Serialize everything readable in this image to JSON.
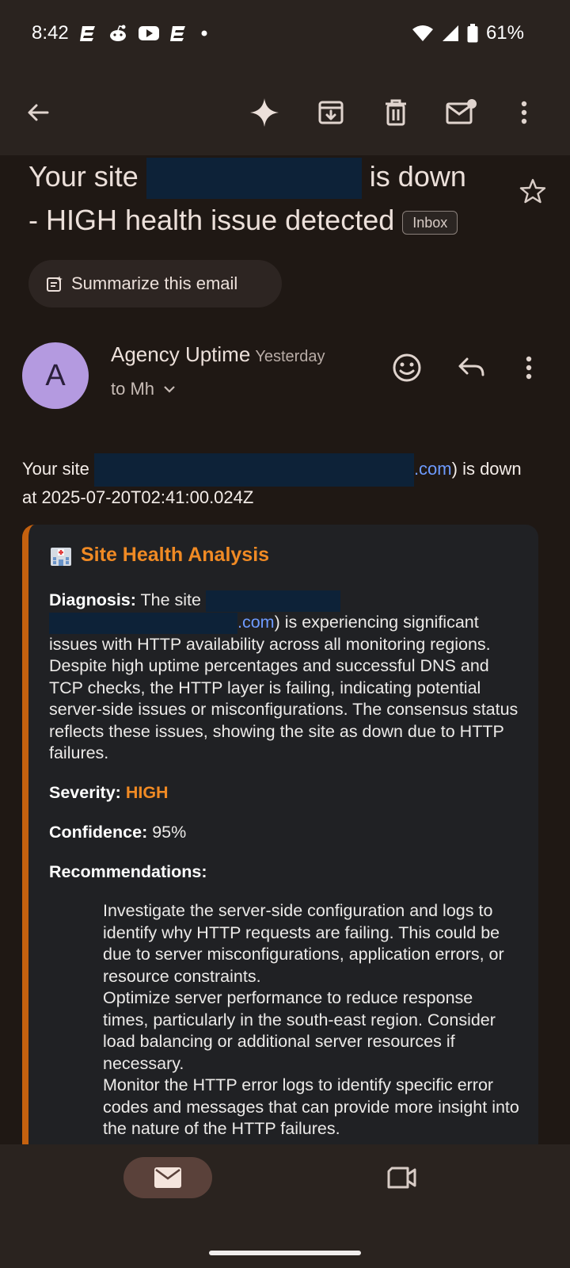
{
  "status_bar": {
    "time": "8:42",
    "battery": "61%",
    "icons_left": [
      "e-app-icon",
      "reddit-icon",
      "youtube-icon",
      "e-app-icon",
      "dot-icon"
    ],
    "icons_right": [
      "wifi-icon",
      "signal-icon",
      "battery-icon"
    ]
  },
  "app_bar": {
    "icons": [
      "back-arrow-icon",
      "gemini-sparkle-icon",
      "archive-icon",
      "delete-icon",
      "mark-unread-icon",
      "more-vert-icon"
    ]
  },
  "email": {
    "subject_part1": "Your site",
    "subject_part2": "is down",
    "subject_part3": "- HIGH health issue detected",
    "label": "Inbox",
    "summarize_label": "Summarize this email",
    "sender_initial": "A",
    "sender_name": "Agency Uptime",
    "time": "Yesterday",
    "recipient": "to Mh",
    "intro_part1": "Your site",
    "intro_link": ".com",
    "intro_part2": ") is down",
    "intro_part3": "at 2025-07-20T02:41:00.024Z"
  },
  "analysis": {
    "title": "Site Health Analysis",
    "diagnosis_label": "Diagnosis:",
    "diagnosis_prefix": "The site",
    "diagnosis_link": ".com",
    "diagnosis_text_line1": ") is experiencing significant",
    "diagnosis_text_rest": "issues with HTTP availability across all monitoring regions. Despite high uptime percentages and successful DNS and TCP checks, the HTTP layer is failing, indicating potential server-side issues or misconfigurations. The consensus status reflects these issues, showing the site as down due to HTTP failures.",
    "severity_label": "Severity:",
    "severity_value": "HIGH",
    "confidence_label": "Confidence:",
    "confidence_value": "95%",
    "recommendations_label": "Recommendations:",
    "recommendations": [
      "Investigate the server-side configuration and logs to identify why HTTP requests are failing. This could be due to server misconfigurations, application errors, or resource constraints.",
      "Optimize server performance to reduce response times, particularly in the south-east region. Consider load balancing or additional server resources if necessary.",
      "Monitor the HTTP error logs to identify specific error codes and messages that can provide more insight into the nature of the HTTP failures."
    ]
  },
  "colors": {
    "accent_orange": "#f08a24",
    "card_border": "#c4610f",
    "link_blue": "#6e9bff",
    "avatar_purple": "#b49ae0",
    "redaction": "#0d2238"
  }
}
